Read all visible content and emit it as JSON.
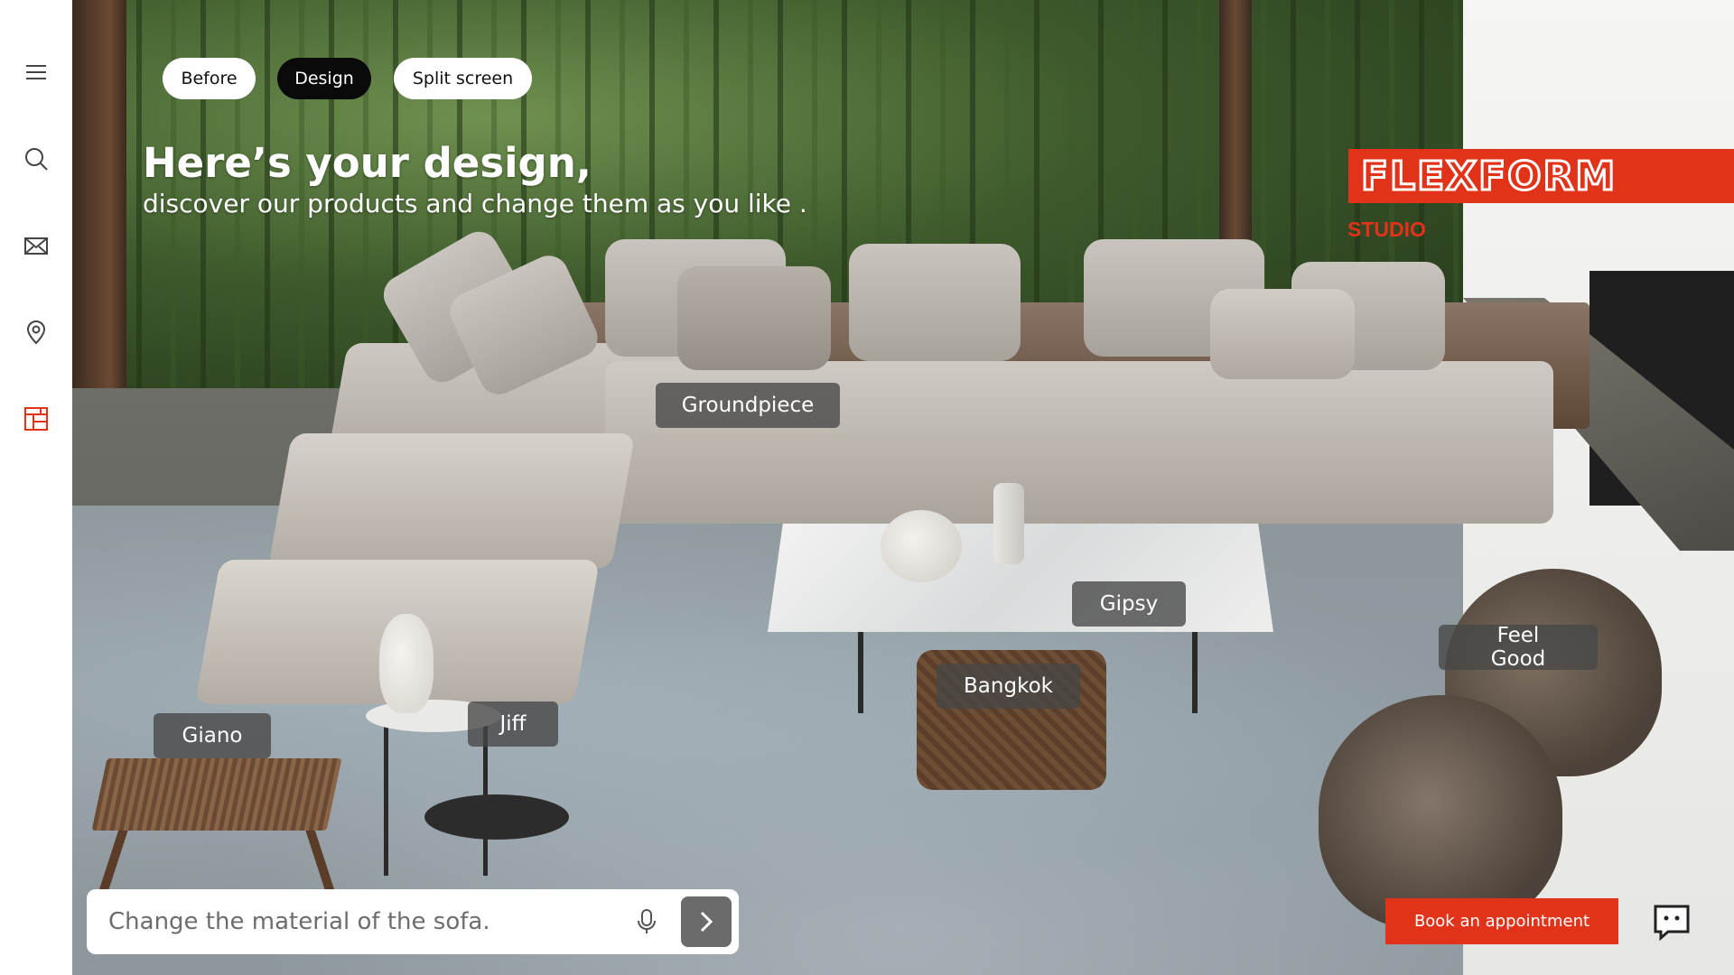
{
  "view_toggle": [
    {
      "label": "Before",
      "active": false
    },
    {
      "label": "Design",
      "active": true
    },
    {
      "label": "Split screen",
      "active": false
    }
  ],
  "headline": "Here’s your design,",
  "subheadline": "discover our products and change them as you like .",
  "brand": {
    "logo": "FLEXFORM",
    "sub": "STUDIO",
    "color": "#e1321a"
  },
  "sidebar": {
    "items": [
      {
        "icon": "menu-icon"
      },
      {
        "icon": "search-icon"
      },
      {
        "icon": "mail-icon"
      },
      {
        "icon": "location-pin-icon"
      },
      {
        "icon": "floorplan-icon",
        "active": true
      }
    ]
  },
  "products": [
    "Groundpiece",
    "Gipsy",
    "Feel Good",
    "Bangkok",
    "Giano",
    "Jiff"
  ],
  "prompt": {
    "placeholder": "Change the material of the sofa."
  },
  "cta": {
    "book": "Book an appointment"
  },
  "accent_color": "#e1321a"
}
